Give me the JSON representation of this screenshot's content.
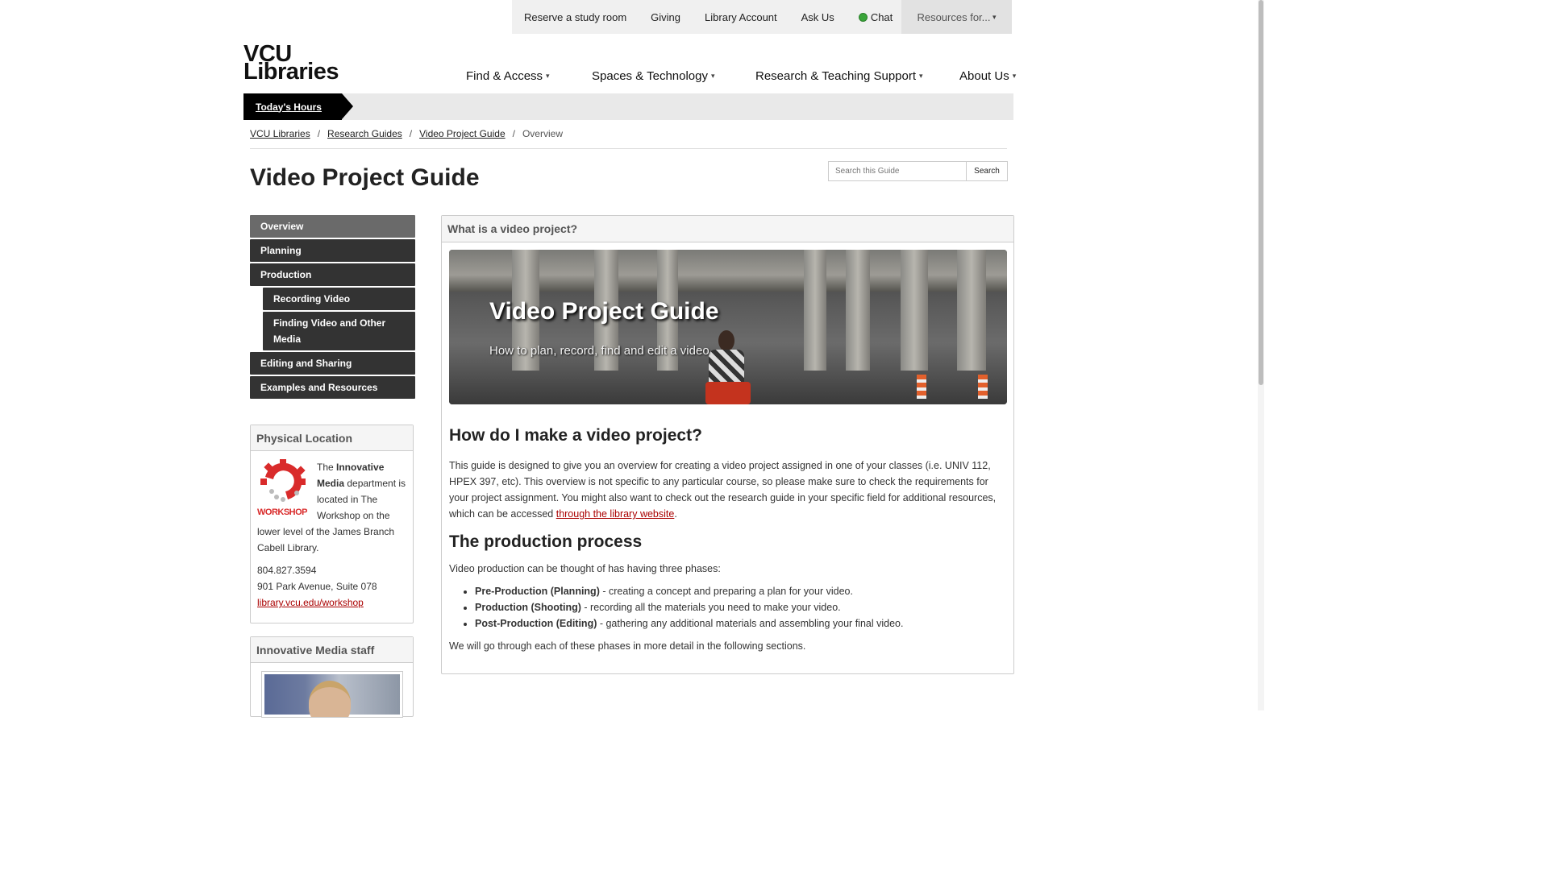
{
  "utility_nav": {
    "items": [
      "Reserve a study room",
      "Giving",
      "Library Account",
      "Ask Us"
    ],
    "chat": "Chat",
    "resources": "Resources for...",
    "chat_status_color": "#3aa53a"
  },
  "logo": {
    "line1": "VCU",
    "line2": "Libraries"
  },
  "main_nav": {
    "items": [
      "Find & Access",
      "Spaces & Technology",
      "Research & Teaching Support",
      "About Us"
    ]
  },
  "hours": {
    "label": "Today's Hours"
  },
  "breadcrumb": {
    "items": [
      "VCU Libraries",
      "Research Guides",
      "Video Project Guide"
    ],
    "current": "Overview",
    "separator": "/"
  },
  "page": {
    "title": "Video Project Guide"
  },
  "guide_search": {
    "placeholder": "Search this Guide",
    "button": "Search"
  },
  "side_nav": {
    "items": [
      "Overview",
      "Planning",
      "Production"
    ],
    "sub_items": [
      "Recording Video",
      "Finding Video and Other Media"
    ],
    "items_after": [
      "Editing and Sharing",
      "Examples and Resources"
    ],
    "active": "Overview"
  },
  "location_box": {
    "title": "Physical Location",
    "logo_word": "WORKSHOP",
    "text_pre": "The ",
    "text_bold": "Innovative Media",
    "text_post": " department is located in The Workshop on the lower level of the James Branch Cabell Library.",
    "phone": "804.827.3594",
    "address": "901 Park Avenue, Suite 078",
    "link": "library.vcu.edu/workshop"
  },
  "staff_box": {
    "title": "Innovative Media staff"
  },
  "content_box": {
    "header": "What is a video project?",
    "banner_title": "Video Project Guide",
    "banner_subtitle": "How to plan, record, find and edit a video",
    "h1": "How do I make a video project?",
    "p1_text": "This guide is designed to give you an overview for creating a video project assigned in one of your classes (i.e. UNIV 112, HPEX 397, etc). This overview is not specific to any particular course, so please make sure to check the requirements for your project assignment. You might also want to check out the research guide in your specific field for additional resources, which can be accessed ",
    "p1_link": "through the library website",
    "p1_end": ".",
    "h2": "The production process",
    "p2": "Video production can be thought of has having three phases:",
    "list": [
      {
        "bold": "Pre-Production (Planning)",
        "text": " - creating a concept and preparing a plan for your video."
      },
      {
        "bold": "Production (Shooting)",
        "text": " - recording all the materials you need to make your video."
      },
      {
        "bold": "Post-Production (Editing)",
        "text": " - gathering any additional materials and assembling your final video."
      }
    ],
    "p3": "We will go through each of these phases in more detail in the following sections."
  }
}
